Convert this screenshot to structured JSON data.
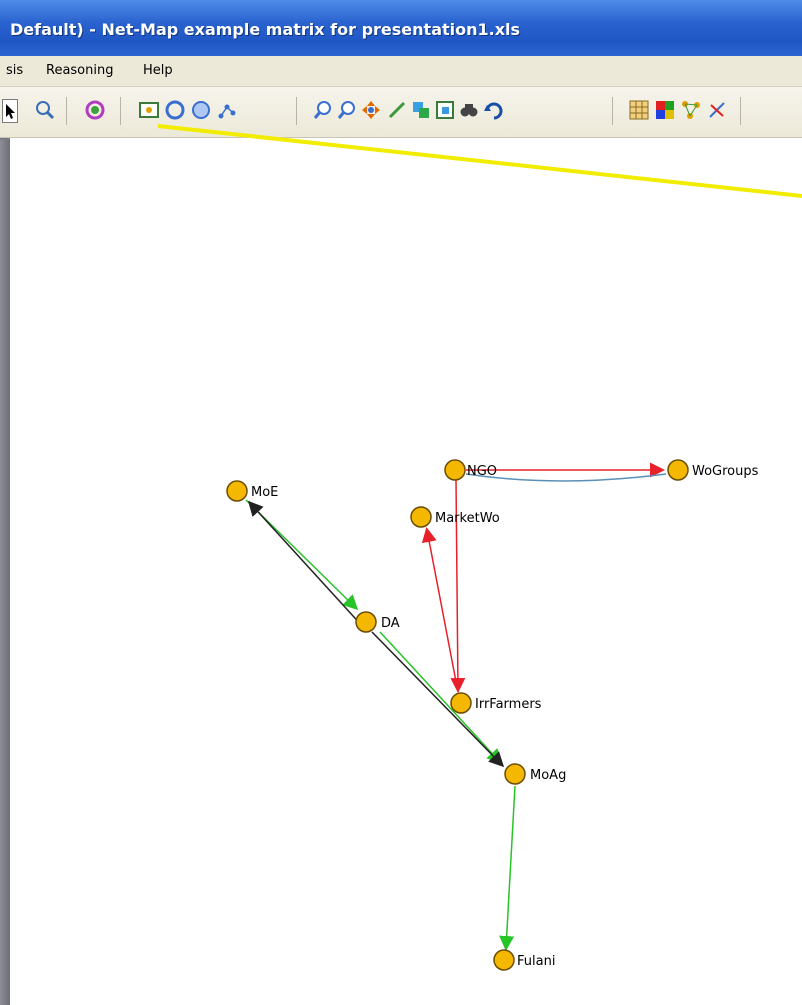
{
  "window": {
    "title": "Default) - Net-Map example matrix for presentation1.xls"
  },
  "menu": {
    "items": [
      "sis",
      "Reasoning",
      "Help"
    ]
  },
  "toolbar": {
    "buttons": [
      "pointer-icon",
      "zoom-icon",
      "refresh-icon",
      "fit-network-icon",
      "circle-layout-icon",
      "sphere-layout-icon",
      "tree-layout-icon",
      "zoom-in-icon",
      "zoom-out-icon",
      "move-icon",
      "edge-tool-icon",
      "copy-icon",
      "paste-icon",
      "find-icon",
      "undo-icon",
      "grid-icon",
      "color-icon",
      "network-icon",
      "delete-icon"
    ]
  },
  "network": {
    "nodes": [
      {
        "id": "MoE",
        "label": "MoE"
      },
      {
        "id": "NGO",
        "label": "NGO"
      },
      {
        "id": "WoGroups",
        "label": "WoGroups"
      },
      {
        "id": "MarketWo",
        "label": "MarketWo"
      },
      {
        "id": "DA",
        "label": "DA"
      },
      {
        "id": "IrrFarmers",
        "label": "IrrFarmers"
      },
      {
        "id": "MoAg",
        "label": "MoAg"
      },
      {
        "id": "Fulani",
        "label": "Fulani"
      }
    ],
    "edges": [
      {
        "from": "NGO",
        "to": "WoGroups",
        "color": "#e8202a"
      },
      {
        "from": "NGO",
        "to": "WoGroups",
        "color": "#5a8fb8"
      },
      {
        "from": "NGO",
        "to": "IrrFarmers",
        "color": "#e8202a"
      },
      {
        "from": "IrrFarmers",
        "to": "MarketWo",
        "color": "#e8202a"
      },
      {
        "from": "MoE",
        "to": "DA",
        "color": "#27c427"
      },
      {
        "from": "DA",
        "to": "MoE",
        "color": "#222222"
      },
      {
        "from": "DA",
        "to": "MoAg",
        "color": "#27c427"
      },
      {
        "from": "DA",
        "to": "MoAg",
        "color": "#222222"
      },
      {
        "from": "MoAg",
        "to": "Fulani",
        "color": "#27c427"
      }
    ]
  },
  "colors": {
    "node_fill": "#f5b800",
    "node_stroke": "#6b4e00",
    "pointer_line": "#f2ec00",
    "titlebar": "#2a63cf"
  }
}
